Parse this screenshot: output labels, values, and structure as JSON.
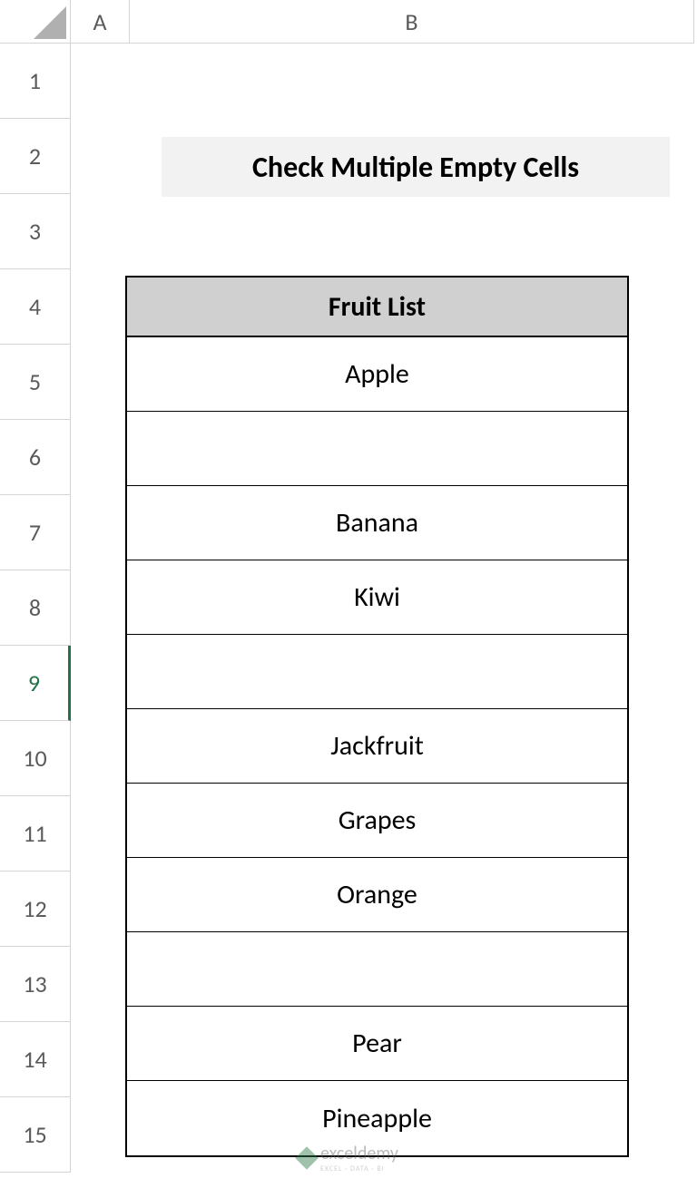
{
  "columns": [
    "A",
    "B"
  ],
  "rows": [
    "1",
    "2",
    "3",
    "4",
    "5",
    "6",
    "7",
    "8",
    "9",
    "10",
    "11",
    "12",
    "13",
    "14",
    "15"
  ],
  "selected_row_index": 8,
  "title": "Check Multiple Empty Cells",
  "table_header": "Fruit List",
  "fruits": [
    "Apple",
    "",
    "Banana",
    "Kiwi",
    "",
    "Jackfruit",
    "Grapes",
    "Orange",
    "",
    "Pear",
    "Pineapple"
  ],
  "watermark": {
    "name": "exceldemy",
    "tagline": "EXCEL · DATA · BI"
  }
}
